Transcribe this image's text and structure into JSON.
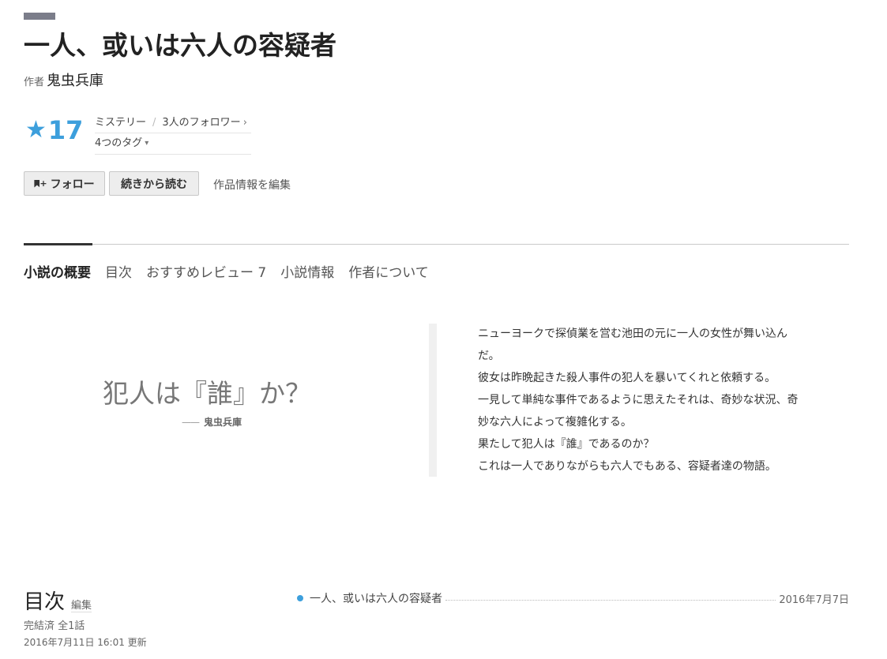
{
  "work": {
    "title": "一人、或いは六人の容疑者",
    "author_label": "作者",
    "author_name": "鬼虫兵庫"
  },
  "stats": {
    "star_icon": "★",
    "star_count": "17",
    "genre": "ミステリー",
    "followers": "3人のフォロワー",
    "tags": "4つのタグ"
  },
  "actions": {
    "follow_label": "フォロー",
    "continue_label": "続きから読む",
    "edit_label": "作品情報を編集"
  },
  "tabs": [
    {
      "label": "小説の概要",
      "active": true
    },
    {
      "label": "目次",
      "active": false
    },
    {
      "label": "おすすめレビュー 7",
      "active": false
    },
    {
      "label": "小説情報",
      "active": false
    },
    {
      "label": "作者について",
      "active": false
    }
  ],
  "summary": {
    "catchphrase": "犯人は『誰』か？",
    "catch_dash": "——",
    "catch_author": "鬼虫兵庫",
    "intro_lines": [
      "ニューヨークで探偵業を営む池田の元に一人の女性が舞い込ん",
      "だ。",
      "彼女は昨晩起きた殺人事件の犯人を暴いてくれと依頼する。",
      "一見して単純な事件であるように思えたそれは、奇妙な状況、奇",
      "妙な六人によって複雑化する。",
      "果たして犯人は『誰』であるのか？",
      "これは一人でありながらも六人でもある、容疑者達の物語。"
    ]
  },
  "toc": {
    "title": "目次",
    "edit_label": "編集",
    "status": "完結済 全1話",
    "updated": "2016年7月11日 16:01 更新",
    "episodes": [
      {
        "title": "一人、或いは六人の容疑者",
        "date": "2016年7月7日"
      }
    ]
  },
  "colors": {
    "accent_blue": "#3d9fdc",
    "genre_bar": "#7b7d8a"
  }
}
